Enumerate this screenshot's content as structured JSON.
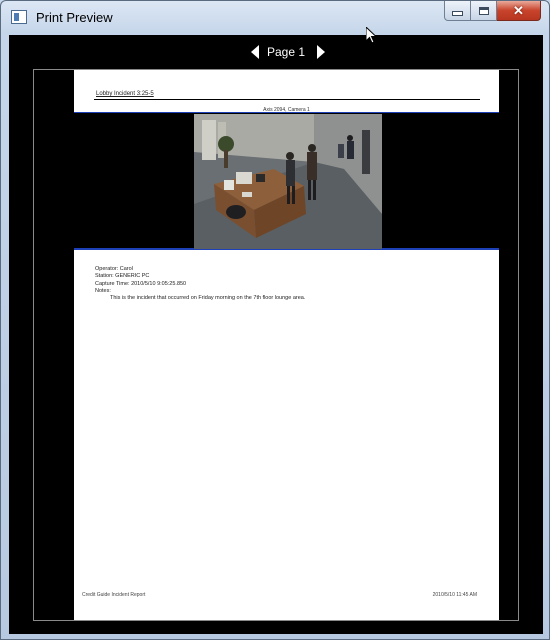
{
  "window": {
    "title": "Print Preview"
  },
  "nav": {
    "page_label": "Page  1"
  },
  "report": {
    "title": "Lobby Incident 3:25-5",
    "caption": "Axis 2094, Camera 1",
    "details": [
      "Operator: Carol",
      "Station: GENERIC PC",
      "Capture Time: 2010/5/10 9:05:25.850",
      "Notes:"
    ],
    "note_text": "This is the incident that occurred on Friday morning on the 7th floor lounge area.",
    "footer_left": "Credit Guide Incident Report",
    "footer_right": "2010/5/10 11:45 AM"
  },
  "colors": {
    "client_bg": "#000000",
    "band_border": "#1d3fb8",
    "close_button": "#c8432b"
  },
  "icons": {
    "app": "print-preview-icon",
    "prev": "triangle-left-icon",
    "next": "triangle-right-icon",
    "minimize": "minimize-icon",
    "maximize": "maximize-icon",
    "close": "close-icon"
  }
}
